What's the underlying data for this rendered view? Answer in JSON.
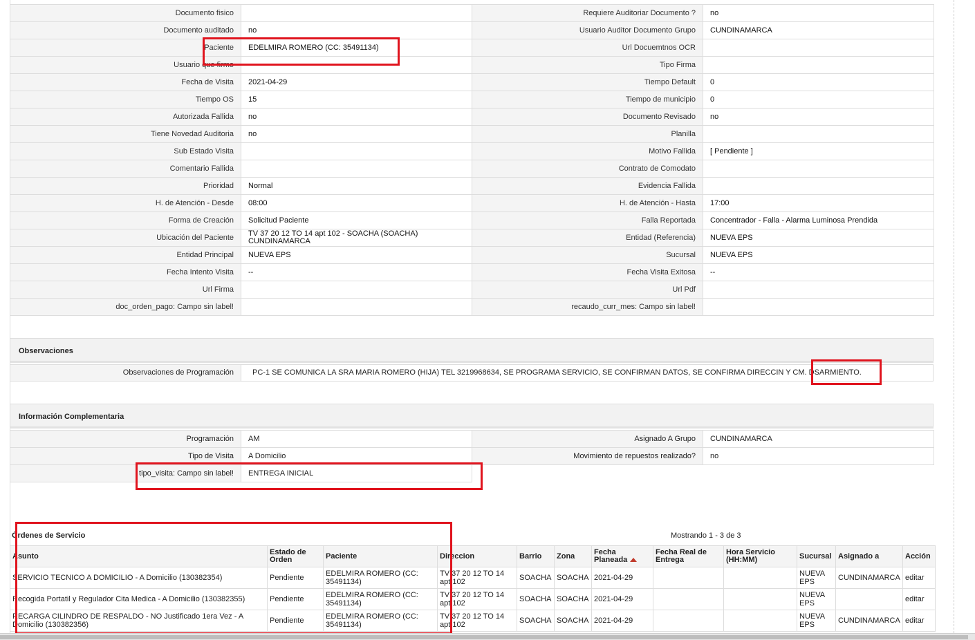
{
  "details": [
    [
      "Documento fisico",
      "",
      "Requiere Auditoriar Documento ?",
      "no"
    ],
    [
      "Documento auditado",
      "no",
      "Usuario Auditor Documento Grupo",
      "CUNDINAMARCA"
    ],
    [
      "Paciente",
      "EDELMIRA ROMERO (CC: 35491134)",
      "Url Docuemtnos OCR",
      ""
    ],
    [
      "Usuario que firmo",
      "",
      "Tipo Firma",
      ""
    ],
    [
      "Fecha de Visita",
      "2021-04-29",
      "Tiempo Default",
      "0"
    ],
    [
      "Tiempo OS",
      "15",
      "Tiempo de municipio",
      "0"
    ],
    [
      "Autorizada Fallida",
      "no",
      "Documento Revisado",
      "no"
    ],
    [
      "Tiene Novedad Auditoria",
      "no",
      "Planilla",
      ""
    ],
    [
      "Sub Estado Visita",
      "",
      "Motivo Fallida",
      "[ Pendiente ]"
    ],
    [
      "Comentario Fallida",
      "",
      "Contrato de Comodato",
      ""
    ],
    [
      "Prioridad",
      "Normal",
      "Evidencia Fallida",
      ""
    ],
    [
      "H. de Atención - Desde",
      "08:00",
      "H. de Atención - Hasta",
      "17:00"
    ],
    [
      "Forma de Creación",
      "Solicitud Paciente",
      "Falla Reportada",
      "Concentrador - Falla - Alarma Luminosa Prendida"
    ],
    [
      "Ubicación del Paciente",
      "TV 37 20 12 TO 14 apt 102 - SOACHA (SOACHA) CUNDINAMARCA",
      "Entidad (Referencia)",
      "NUEVA EPS"
    ],
    [
      "Entidad Principal",
      "NUEVA EPS",
      "Sucursal",
      "NUEVA EPS"
    ],
    [
      "Fecha Intento Visita",
      "--",
      "Fecha Visita Exitosa",
      "--"
    ],
    [
      "Url Firma",
      "",
      "Url Pdf",
      ""
    ],
    [
      "doc_orden_pago: Campo sin label!",
      "",
      "recaudo_curr_mes: Campo sin label!",
      ""
    ]
  ],
  "observaciones": {
    "title": "Observaciones",
    "label": "Observaciones de Programación",
    "value": "PC-1 SE COMUNICA LA SRA MARIA ROMERO (HIJA) TEL 3219968634, SE PROGRAMA SERVICIO, SE CONFIRMAN DATOS, SE CONFIRMA DIRECCIN Y CM. DSARMIENTO."
  },
  "info": {
    "title": "Información Complementaria",
    "rows": [
      [
        "Programación",
        "AM",
        "Asignado A Grupo",
        "CUNDINAMARCA"
      ],
      [
        "Tipo de Visita",
        "A Domicilio",
        "Movimiento de repuestos realizado?",
        "no"
      ],
      [
        "tipo_visita: Campo sin label!",
        "ENTREGA INICIAL",
        "",
        ""
      ]
    ]
  },
  "orders": {
    "title": "Órdenes de Servicio",
    "count": "Mostrando 1 - 3 de 3",
    "columns": [
      "Asunto",
      "Estado de Orden",
      "Paciente",
      "Direccion",
      "Barrio",
      "Zona",
      "Fecha Planeada",
      "Fecha Real de Entrega",
      "Hora Servicio (HH:MM)",
      "Sucursal",
      "Asignado a",
      "Acción"
    ],
    "rows": [
      [
        "SERVICIO TECNICO A DOMICILIO - A Domicilio (130382354)",
        "Pendiente",
        "EDELMIRA ROMERO (CC: 35491134)",
        "TV 37 20 12 TO 14 apt 102",
        "SOACHA",
        "SOACHA",
        "2021-04-29",
        "",
        "",
        "NUEVA EPS",
        "CUNDINAMARCA",
        "editar"
      ],
      [
        "Recogida Portatil y Regulador Cita Medica - A Domicilio (130382355)",
        "Pendiente",
        "EDELMIRA ROMERO (CC: 35491134)",
        "TV 37 20 12 TO 14 apt 102",
        "SOACHA",
        "SOACHA",
        "2021-04-29",
        "",
        "",
        "NUEVA EPS",
        "",
        "editar"
      ],
      [
        "RECARGA CILINDRO DE RESPALDO - NO Justificado 1era Vez - A Domicilio (130382356)",
        "Pendiente",
        "EDELMIRA ROMERO (CC: 35491134)",
        "TV 37 20 12 TO 14 apt 102",
        "SOACHA",
        "SOACHA",
        "2021-04-29",
        "",
        "",
        "NUEVA EPS",
        "CUNDINAMARCA",
        "editar"
      ]
    ]
  },
  "colors": {
    "highlight": "#e0141e",
    "sort_arrow": "#c0392b"
  }
}
